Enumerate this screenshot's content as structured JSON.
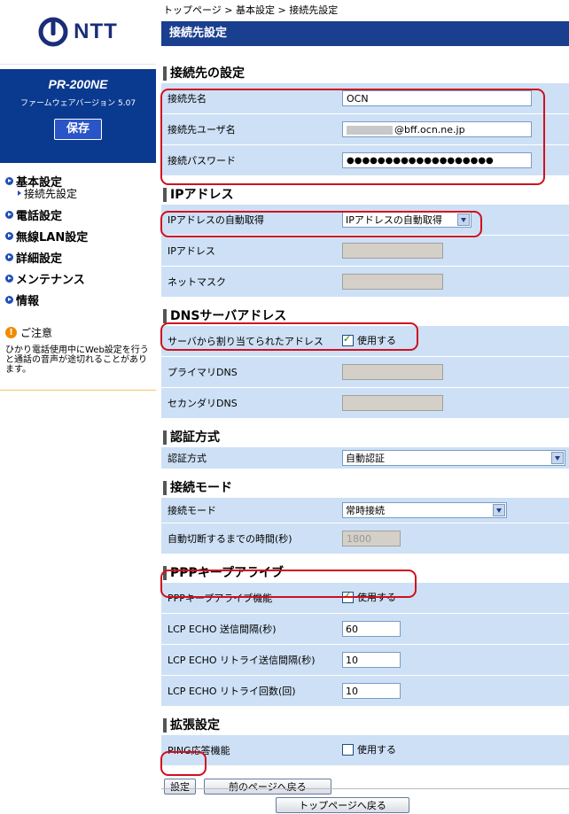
{
  "brand": {
    "logo_text": "NTT",
    "model": "PR-200NE",
    "firmware": "ファームウェアバージョン 5.07",
    "save_label": "保存"
  },
  "nav": {
    "items": [
      {
        "label": "基本設定"
      },
      {
        "label": "電話設定"
      },
      {
        "label": "無線LAN設定"
      },
      {
        "label": "詳細設定"
      },
      {
        "label": "メンテナンス"
      },
      {
        "label": "情報"
      }
    ],
    "sub_item": "接続先設定"
  },
  "notice": {
    "title": "ご注意",
    "body": "ひかり電話使用中にWeb設定を行うと通話の音声が途切れることがあります。"
  },
  "breadcrumb": "トップページ > 基本設定 > 接続先設定",
  "page_title": "接続先設定",
  "sections": {
    "conn": {
      "title": "接続先の設定",
      "name_label": "接続先名",
      "name_value": "OCN",
      "user_label": "接続先ユーザ名",
      "user_value": "@bff.ocn.ne.jp",
      "pass_label": "接続パスワード",
      "pass_value": "●●●●●●●●●●●●●●●●●●●"
    },
    "ip": {
      "title": "IPアドレス",
      "auto_label": "IPアドレスの自動取得",
      "auto_value": "IPアドレスの自動取得",
      "addr_label": "IPアドレス",
      "mask_label": "ネットマスク"
    },
    "dns": {
      "title": "DNSサーバアドレス",
      "assigned_label": "サーバから割り当てられたアドレス",
      "use_label": "使用する",
      "primary_label": "プライマリDNS",
      "secondary_label": "セカンダリDNS"
    },
    "auth": {
      "title": "認証方式",
      "label": "認証方式",
      "value": "自動認証"
    },
    "mode": {
      "title": "接続モード",
      "label": "接続モード",
      "value": "常時接続",
      "timeout_label": "自動切断するまでの時間(秒)",
      "timeout_value": "1800"
    },
    "ppp": {
      "title": "PPPキープアライブ",
      "func_label": "PPPキープアライブ機能",
      "use_label": "使用する",
      "interval_label": "LCP ECHO 送信間隔(秒)",
      "interval_value": "60",
      "retry_interval_label": "LCP ECHO リトライ送信間隔(秒)",
      "retry_interval_value": "10",
      "retry_count_label": "LCP ECHO リトライ回数(回)",
      "retry_count_value": "10"
    },
    "ext": {
      "title": "拡張設定",
      "ping_label": "PING応答機能",
      "use_label": "使用する"
    }
  },
  "buttons": {
    "apply": "設定",
    "back": "前のページへ戻る",
    "top": "トップページへ戻る"
  },
  "colors": {
    "title_bar": "#1a3f8f",
    "field_bg": "#cde0f5",
    "highlight": "#d0101e",
    "model_bg": "#0a3a8f"
  }
}
